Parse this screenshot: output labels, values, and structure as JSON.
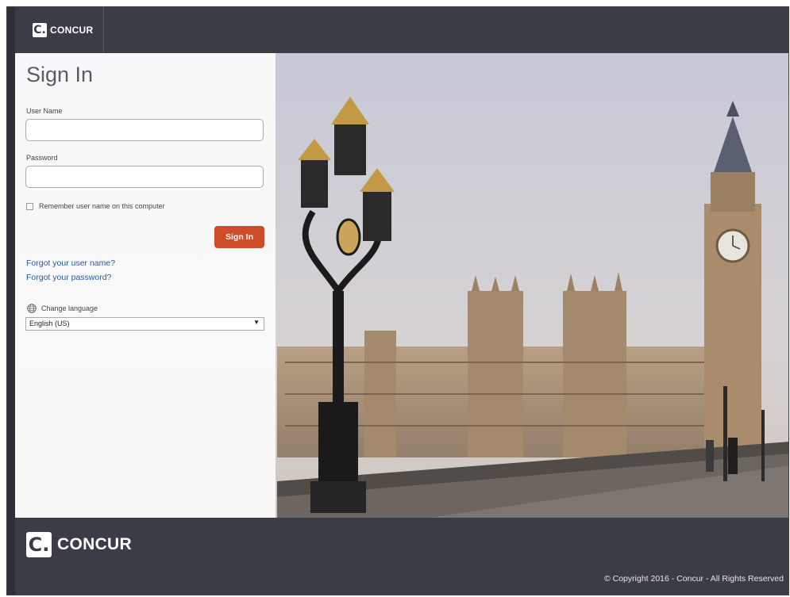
{
  "header": {
    "logo_mark": "C.",
    "logo_text": "CONCUR"
  },
  "signin": {
    "title": "Sign In",
    "username_label": "User Name",
    "username_value": "",
    "password_label": "Password",
    "password_value": "",
    "remember_label": "Remember user name on this computer",
    "remember_checked": false,
    "button_label": "Sign In",
    "forgot_username": "Forgot your user name?",
    "forgot_password": "Forgot your password?",
    "change_language_label": "Change language",
    "language_selected": "English (US)"
  },
  "footer": {
    "logo_mark": "C.",
    "logo_text": "CONCUR",
    "copyright": "© Copyright 2016 - Concur - All Rights Reserved"
  },
  "colors": {
    "header_bg": "#3a3d45",
    "accent": "#cd4d2a",
    "link": "#2a5a9c"
  },
  "icons": [
    "globe-icon",
    "dropdown-arrow-icon"
  ]
}
